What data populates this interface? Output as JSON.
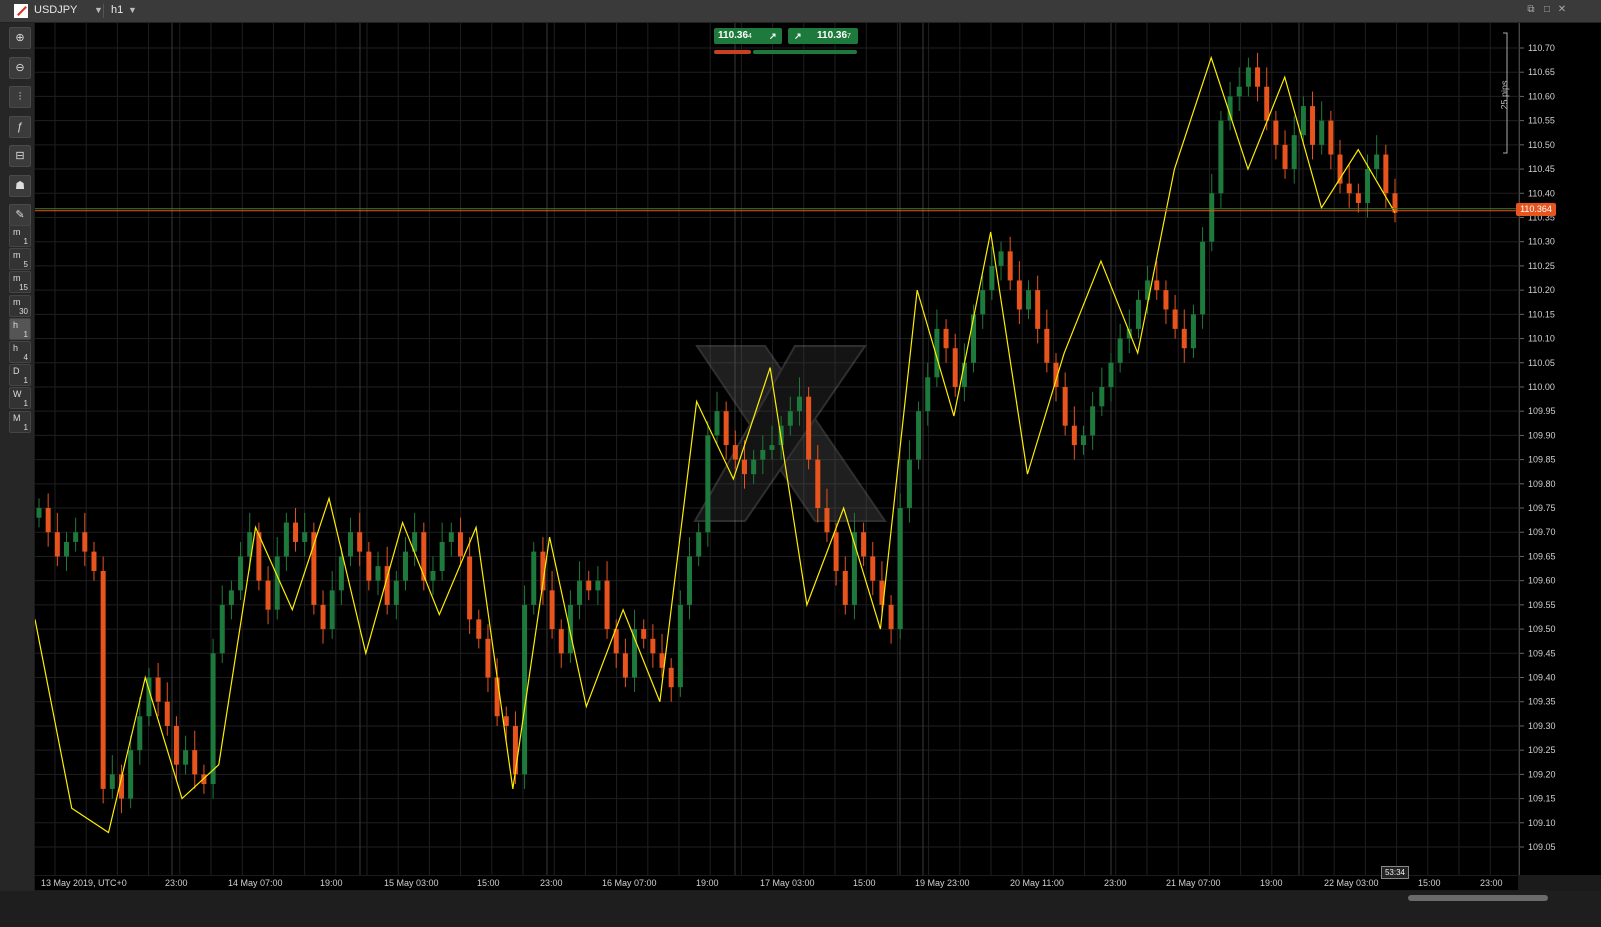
{
  "header": {
    "symbol": "USDJPY",
    "timeframe": "h1"
  },
  "toolbar": {
    "tools": [
      {
        "name": "zoom-in-icon",
        "glyph": "⊕"
      },
      {
        "name": "zoom-out-icon",
        "glyph": "⊖"
      },
      {
        "name": "chart-type-icon",
        "glyph": "⫶"
      },
      {
        "name": "indicators-icon",
        "glyph": "ƒ"
      },
      {
        "name": "cbot-icon",
        "glyph": "⊟"
      },
      {
        "name": "trader-icon",
        "glyph": "☗"
      },
      {
        "name": "drawing-tools-icon",
        "glyph": "✎"
      }
    ],
    "timeframes": [
      {
        "a": "m",
        "b": "1"
      },
      {
        "a": "m",
        "b": "5"
      },
      {
        "a": "m",
        "b": "15"
      },
      {
        "a": "m",
        "b": "30"
      },
      {
        "a": "h",
        "b": "1"
      },
      {
        "a": "h",
        "b": "4"
      },
      {
        "a": "D",
        "b": "1"
      },
      {
        "a": "W",
        "b": "1"
      },
      {
        "a": "M",
        "b": "1"
      }
    ]
  },
  "quotes": {
    "bid_main": "110.36",
    "bid_pip": "4",
    "ask_main": "110.36",
    "ask_pip": "7"
  },
  "current_price": "110.364",
  "countdown": "53:34",
  "pips_scale_label": "25 pips",
  "colors": {
    "background": "#000000",
    "bull": "#1e7a3c",
    "bear": "#e8541e",
    "zigzag": "#ffee00",
    "price_line": "#e8541e",
    "grid": "#1f1f1f"
  },
  "chart_data": {
    "type": "candlestick",
    "price_axis": {
      "min": 109.0,
      "max": 110.72,
      "ticks": [
        "110.70",
        "110.65",
        "110.60",
        "110.55",
        "110.50",
        "110.45",
        "110.40",
        "110.35",
        "110.30",
        "110.25",
        "110.20",
        "110.15",
        "110.10",
        "110.05",
        "110.00",
        "109.95",
        "109.90",
        "109.85",
        "109.80",
        "109.75",
        "109.70",
        "109.65",
        "109.60",
        "109.55",
        "109.50",
        "109.45",
        "109.40",
        "109.35",
        "109.30",
        "109.25",
        "109.20",
        "109.15",
        "109.10",
        "109.05"
      ]
    },
    "time_axis": {
      "labels": [
        "13 May 2019, UTC+0",
        "23:00",
        "14 May 07:00",
        "19:00",
        "15 May 03:00",
        "15:00",
        "23:00",
        "16 May 07:00",
        "19:00",
        "17 May 03:00",
        "15:00",
        "19 May 23:00",
        "20 May 11:00",
        "23:00",
        "21 May 07:00",
        "19:00",
        "22 May 03:00",
        "15:00",
        "23:00"
      ]
    },
    "zigzag": [
      109.52,
      109.13,
      109.08,
      109.4,
      109.15,
      109.22,
      109.71,
      109.54,
      109.77,
      109.45,
      109.72,
      109.53,
      109.71,
      109.17,
      109.69,
      109.34,
      109.54,
      109.35,
      109.97,
      109.81,
      110.04,
      109.55,
      109.75,
      109.5,
      110.2,
      109.94,
      110.32,
      109.82,
      110.07,
      110.26,
      110.07,
      110.45,
      110.68,
      110.45,
      110.64,
      110.37,
      110.49,
      110.36
    ],
    "candles": {
      "closes": [
        109.75,
        109.7,
        109.65,
        109.68,
        109.7,
        109.66,
        109.62,
        109.17,
        109.2,
        109.15,
        109.25,
        109.32,
        109.4,
        109.35,
        109.3,
        109.22,
        109.25,
        109.2,
        109.18,
        109.45,
        109.55,
        109.58,
        109.65,
        109.7,
        109.6,
        109.54,
        109.65,
        109.72,
        109.68,
        109.7,
        109.55,
        109.5,
        109.58,
        109.65,
        109.7,
        109.66,
        109.6,
        109.63,
        109.55,
        109.6,
        109.66,
        109.7,
        109.6,
        109.62,
        109.68,
        109.7,
        109.65,
        109.52,
        109.48,
        109.4,
        109.32,
        109.3,
        109.2,
        109.55,
        109.66,
        109.58,
        109.5,
        109.45,
        109.55,
        109.6,
        109.58,
        109.6,
        109.5,
        109.45,
        109.4,
        109.5,
        109.48,
        109.45,
        109.42,
        109.38,
        109.55,
        109.65,
        109.7,
        109.9,
        109.95,
        109.88,
        109.85,
        109.82,
        109.85,
        109.87,
        109.88,
        109.92,
        109.95,
        109.98,
        109.85,
        109.75,
        109.7,
        109.62,
        109.55,
        109.7,
        109.65,
        109.6,
        109.55,
        109.5,
        109.75,
        109.85,
        109.95,
        110.02,
        110.12,
        110.08,
        110.0,
        110.05,
        110.15,
        110.2,
        110.25,
        110.28,
        110.22,
        110.16,
        110.2,
        110.12,
        110.05,
        110.0,
        109.92,
        109.88,
        109.9,
        109.96,
        110.0,
        110.05,
        110.1,
        110.12,
        110.18,
        110.22,
        110.2,
        110.16,
        110.12,
        110.08,
        110.15,
        110.3,
        110.4,
        110.55,
        110.6,
        110.62,
        110.66,
        110.62,
        110.55,
        110.5,
        110.45,
        110.52,
        110.58,
        110.5,
        110.55,
        110.48,
        110.42,
        110.4,
        110.38,
        110.45,
        110.48,
        110.4,
        110.36
      ]
    }
  }
}
